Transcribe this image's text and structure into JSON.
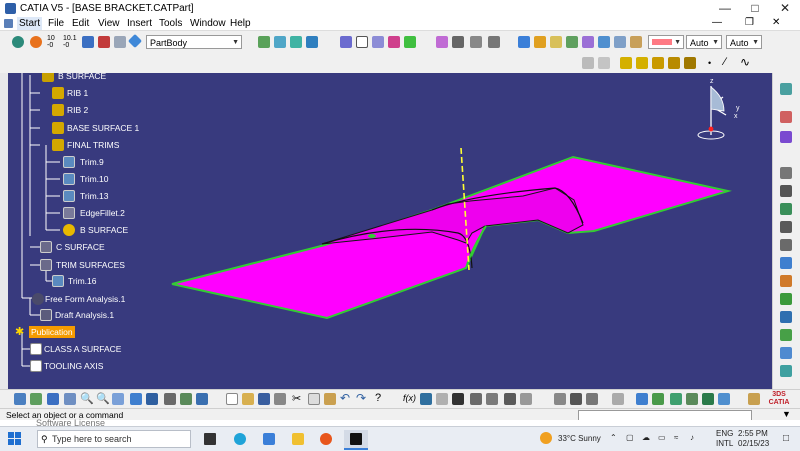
{
  "window": {
    "title": "CATIA V5 - [BASE BRACKET.CATPart]"
  },
  "menu": [
    "Start",
    "File",
    "Edit",
    "View",
    "Insert",
    "Tools",
    "Window",
    "Help"
  ],
  "toolbar": {
    "body_selector": "PartBody",
    "color_value": "",
    "line_thickness": "Auto",
    "line_type": "Auto"
  },
  "tree": {
    "items": [
      {
        "label": "B SURFACE"
      },
      {
        "label": "RIB 1"
      },
      {
        "label": "RIB 2"
      },
      {
        "label": "BASE SURFACE 1"
      },
      {
        "label": "FINAL TRIMS"
      },
      {
        "label": "Trim.9"
      },
      {
        "label": "Trim.10"
      },
      {
        "label": "Trim.13"
      },
      {
        "label": "EdgeFillet.2"
      },
      {
        "label": "B SURFACE"
      },
      {
        "label": "C SURFACE"
      },
      {
        "label": "TRIM SURFACES"
      },
      {
        "label": "Trim.16"
      },
      {
        "label": "Free Form Analysis.1"
      },
      {
        "label": "Draft Analysis.1"
      },
      {
        "label": "Publication"
      },
      {
        "label": "CLASS A SURFACE"
      },
      {
        "label": "TOOLING AXIS"
      }
    ]
  },
  "compass": {
    "x": "x",
    "y": "y",
    "z": "z"
  },
  "status": {
    "message": "Select an object or a command"
  },
  "behind_text": "Software License",
  "taskbar": {
    "search_placeholder": "Type here to search",
    "weather": "33°C  Sunny",
    "lang_top": "ENG",
    "lang_bottom": "INTL",
    "time": "2:55 PM",
    "date": "02/15/23"
  },
  "colors": {
    "viewport_bg": "#383a7e",
    "surface": "#ff00ff",
    "edge": "#33cc33",
    "highlight_publication": "#f59b00"
  }
}
